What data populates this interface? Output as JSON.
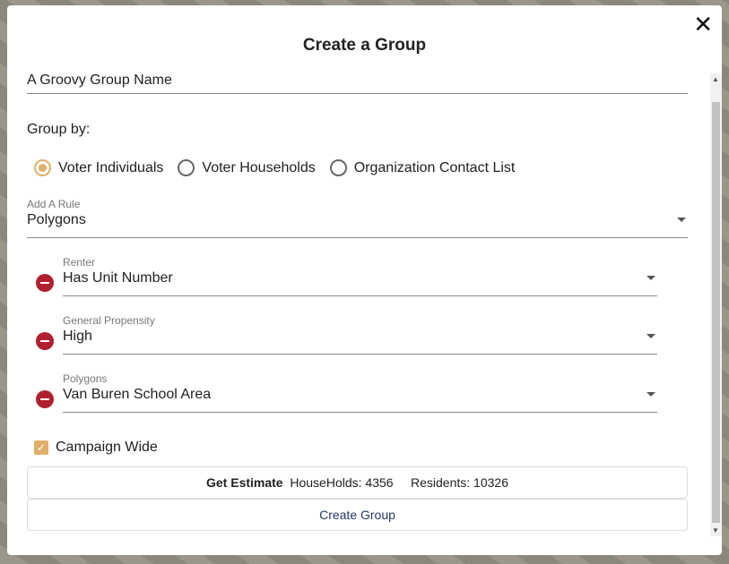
{
  "modal": {
    "title": "Create a Group",
    "close_icon": "close-icon",
    "group_name": "A Groovy Group Name",
    "group_by_label": "Group by:",
    "group_by_options": [
      {
        "label": "Voter Individuals",
        "selected": true
      },
      {
        "label": "Voter Households",
        "selected": false
      },
      {
        "label": "Organization Contact List",
        "selected": false
      }
    ],
    "add_rule": {
      "label": "Add A Rule",
      "value": "Polygons"
    },
    "rules": [
      {
        "label": "Renter",
        "value": "Has Unit Number"
      },
      {
        "label": "General Propensity",
        "value": "High"
      },
      {
        "label": "Polygons",
        "value": "Van Buren School Area"
      }
    ],
    "campaign_wide": {
      "label": "Campaign Wide",
      "checked": true
    },
    "estimate": {
      "button": "Get Estimate",
      "households": "HouseHolds: 4356",
      "residents": "Residents: 10326"
    },
    "create_button": "Create Group",
    "accent_color": "#e0b06a",
    "remove_color": "#b0202e"
  }
}
